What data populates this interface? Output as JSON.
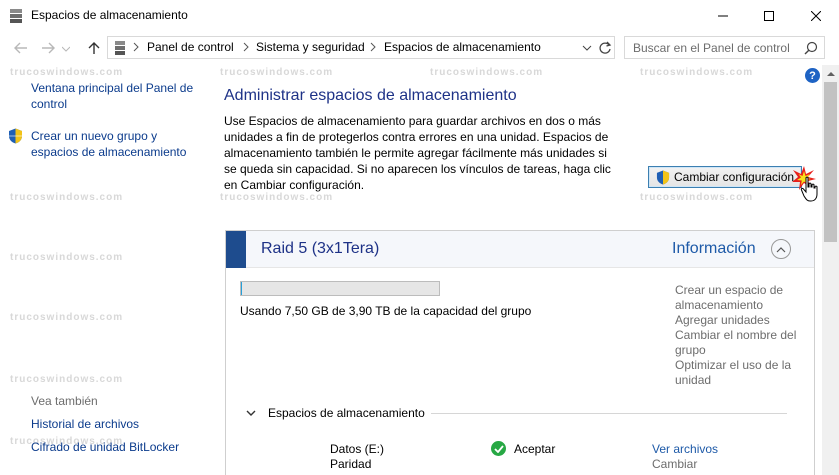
{
  "window": {
    "title": "Espacios de almacenamiento"
  },
  "address": {
    "crumbs": [
      "Panel de control",
      "Sistema y seguridad",
      "Espacios de almacenamiento"
    ]
  },
  "search": {
    "placeholder": "Buscar en el Panel de control"
  },
  "sidebar": {
    "main_link": "Ventana principal del Panel de control",
    "create_link": "Crear un nuevo grupo y espacios de almacenamiento",
    "see_also_label": "Vea también",
    "see_also": [
      "Historial de archivos",
      "Cifrado de unidad BitLocker"
    ]
  },
  "main": {
    "title": "Administrar espacios de almacenamiento",
    "description": "Use Espacios de almacenamiento para guardar archivos en dos o más unidades a fin de protegerlos contra errores en una unidad. Espacios de almacenamiento también le permite agregar fácilmente más unidades si se queda sin capacidad. Si no aparecen los vínculos de tareas, haga clic en Cambiar configuración.",
    "change_settings_label": "Cambiar configuración",
    "help_label": "?"
  },
  "pool": {
    "name": "Raid 5 (3x1Tera)",
    "info_label": "Información",
    "usage_fraction": 0.0019,
    "usage_text": "Usando 7,50 GB de 3,90 TB de la capacidad del grupo",
    "tasks": [
      "Crear un espacio de almacenamiento",
      "Agregar unidades",
      "Cambiar el nombre del grupo",
      "Optimizar el uso de la unidad"
    ],
    "spaces_label": "Espacios de almacenamiento",
    "spaces": [
      {
        "name": "Datos (E:)",
        "type": "Paridad",
        "status": "Aceptar",
        "link1": "Ver archivos",
        "link2": "Cambiar"
      }
    ]
  },
  "watermark_text": "trucoswindows.com",
  "colors": {
    "link": "#0b3b8c",
    "title": "#1e3287",
    "accent": "#1e4c8e",
    "ok": "#27a844",
    "disabled_link": "#6d6d6d"
  }
}
